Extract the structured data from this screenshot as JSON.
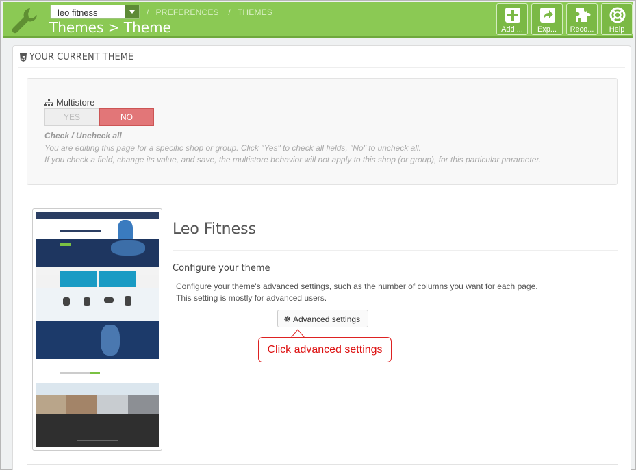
{
  "header": {
    "shop_selector": "leo fitness",
    "breadcrumb": [
      "PREFERENCES",
      "THEMES"
    ],
    "title": "Themes > Theme",
    "toolbar": [
      {
        "label": "Add ...",
        "icon": "plus-icon"
      },
      {
        "label": "Exp...",
        "icon": "export-icon"
      },
      {
        "label": "Reco...",
        "icon": "puzzle-icon"
      },
      {
        "label": "Help",
        "icon": "lifebuoy-icon"
      }
    ]
  },
  "panel": {
    "title": "YOUR CURRENT THEME",
    "multistore": {
      "label": "Multistore",
      "yes": "YES",
      "no": "NO",
      "selected": "NO",
      "check_label": "Check / Uncheck all",
      "help_1": "You are editing this page for a specific shop or group. Click \"Yes\" to check all fields, \"No\" to uncheck all.",
      "help_2": "If you check a field, change its value, and save, the multistore behavior will not apply to this shop (or group), for this particular parameter."
    },
    "theme": {
      "name": "Leo Fitness",
      "configure_title": "Configure your theme",
      "configure_desc_1": "Configure your theme's advanced settings, such as the number of columns you want for each page.",
      "configure_desc_2": "This setting is mostly for advanced users.",
      "advanced_button": "Advanced settings",
      "callout": "Click advanced settings"
    }
  },
  "colors": {
    "header_green": "#8bc954",
    "no_red": "#e27678",
    "callout_red": "#d11111"
  }
}
